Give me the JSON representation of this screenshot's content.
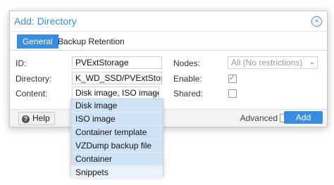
{
  "dialog": {
    "title": "Add: Directory",
    "close_glyph": "×",
    "tabs": [
      {
        "label": "General"
      },
      {
        "label": "Backup Retention"
      }
    ],
    "form": {
      "id_label": "ID:",
      "id_value": "PVExtStorage",
      "directory_label": "Directory:",
      "directory_value": "K_WD_SSD/PVExtStorage/",
      "content_label": "Content:",
      "content_value": "Disk image, ISO image,",
      "content_arrow": "⌄",
      "nodes_label": "Nodes:",
      "nodes_value": "All (No restrictions)",
      "nodes_arrow": "⌄",
      "enable_label": "Enable:",
      "enable_checked": true,
      "enable_check_glyph": "✓",
      "shared_label": "Shared:",
      "shared_checked": false
    },
    "footer": {
      "help_label": "Help",
      "help_icon_glyph": "?",
      "advanced_label": "Advanced",
      "add_label": "Add"
    }
  },
  "content_options": [
    "Disk image",
    "ISO image",
    "Container template",
    "VZDump backup file",
    "Container",
    "Snippets"
  ],
  "colors": {
    "accent": "#3a8dde",
    "option_selected_bg": "#cfe3f7"
  }
}
